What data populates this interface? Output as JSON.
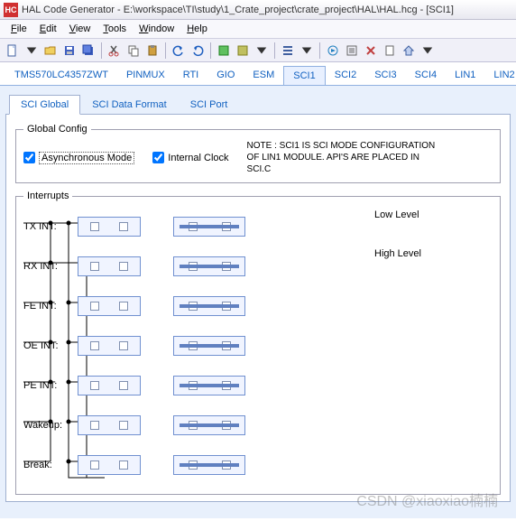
{
  "title": "HAL Code Generator - E:\\workspace\\TI\\study\\1_Crate_project\\crate_project\\HAL\\HAL.hcg - [SCI1]",
  "menu": [
    "File",
    "Edit",
    "View",
    "Tools",
    "Window",
    "Help"
  ],
  "secTabs": [
    "TMS570LC4357ZWT",
    "PINMUX",
    "RTI",
    "GIO",
    "ESM",
    "SCI1",
    "SCI2",
    "SCI3",
    "SCI4",
    "LIN1",
    "LIN2"
  ],
  "secActive": 5,
  "innerTabs": [
    "SCI Global",
    "SCI Data Format",
    "SCI Port"
  ],
  "innerActive": 0,
  "global": {
    "legend": "Global Config",
    "async": "Asynchronous Mode",
    "clock": "Internal Clock",
    "note": "NOTE : SCI1 IS SCI MODE CONFIGURATION OF LIN1 MODULE. API'S ARE PLACED IN SCI.C"
  },
  "interrupts": {
    "legend": "Interrupts",
    "rows": [
      "TX INT:",
      "RX INT:",
      "FE INT:",
      "OE INT:",
      "PE INT:",
      "Wakeup:",
      "Break:"
    ],
    "low": "Low Level",
    "high": "High Level"
  },
  "watermark": "CSDN @xiaoxiao楠楠"
}
